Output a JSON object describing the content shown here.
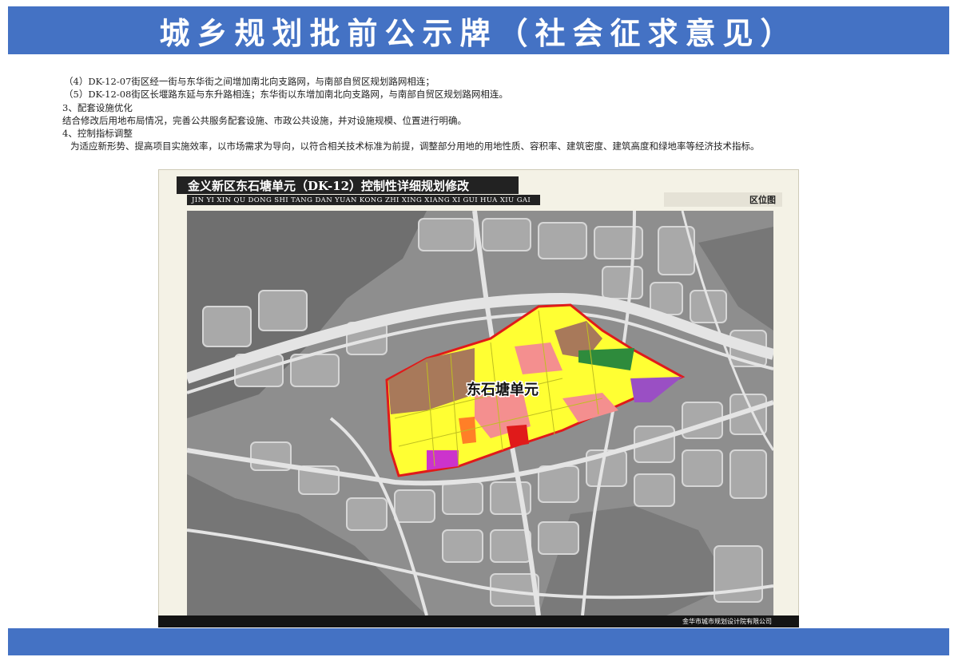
{
  "header": {
    "title": "城乡规划批前公示牌（社会征求意见）"
  },
  "content": {
    "lines": [
      "（4）DK-12-07街区经一街与东华街之间增加南北向支路网，与南部自贸区规划路网相连；",
      "（5）DK-12-08街区长堰路东延与东升路相连；东华街以东增加南北向支路网，与南部自贸区规划路网相连。",
      "3、配套设施优化",
      "结合修改后用地布局情况，完善公共服务配套设施、市政公共设施，并对设施规模、位置进行明确。",
      "4、控制指标调整",
      "为适应新形势、提高项目实施效率，以市场需求为导向，以符合相关技术标准为前提，调整部分用地的用地性质、容积率、建筑密度、建筑高度和绿地率等经济技术指标。"
    ]
  },
  "map_panel": {
    "title": "金义新区东石塘单元（DK-12）控制性详细规划修改",
    "subtitle": "JIN YI XIN QU DONG SHI TANG DAN YUAN KONG ZHI XING XIANG XI GUI HUA XIU GAI",
    "location_label": "区位图",
    "unit_label": "东石塘单元",
    "footer": "金华市城市规划设计院有限公司",
    "colors": {
      "boundary": "#e01a1a",
      "residential": "#ffff33",
      "commercial": "#f48f8f",
      "industrial": "#a8795a",
      "green": "#2e8b3c",
      "public": "#9a4fc4",
      "basemap": "#8f8f8f"
    }
  }
}
